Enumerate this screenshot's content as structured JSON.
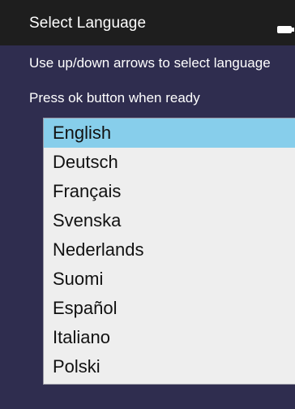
{
  "header": {
    "title": "Select Language",
    "icon": "battery-icon",
    "icon_color": "#ffffff",
    "background": "#1e1e1e"
  },
  "instructions": {
    "line1": "Use up/down arrows to select language",
    "line2": "Press ok button when ready"
  },
  "languages": {
    "items": [
      {
        "label": "English",
        "selected": true
      },
      {
        "label": "Deutsch",
        "selected": false
      },
      {
        "label": "Français",
        "selected": false
      },
      {
        "label": "Svenska",
        "selected": false
      },
      {
        "label": "Nederlands",
        "selected": false
      },
      {
        "label": "Suomi",
        "selected": false
      },
      {
        "label": "Español",
        "selected": false
      },
      {
        "label": "Italiano",
        "selected": false
      },
      {
        "label": "Polski",
        "selected": false
      }
    ],
    "selected_color": "#87ceeb",
    "list_background": "#eeeeee"
  },
  "background_color": "#2f2d4f"
}
